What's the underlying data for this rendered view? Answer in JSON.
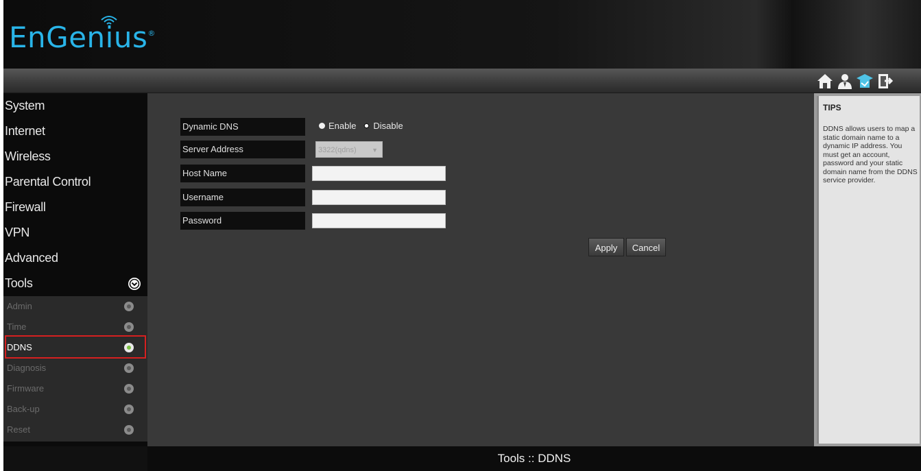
{
  "brand": {
    "logo_text": "EnGenius",
    "logo_color": "#29b4e8"
  },
  "toolbar": {
    "icons": [
      "home-icon",
      "user-icon",
      "wizard-icon",
      "logout-icon"
    ]
  },
  "sidebar": {
    "items": [
      {
        "label": "System"
      },
      {
        "label": "Internet"
      },
      {
        "label": "Wireless"
      },
      {
        "label": "Parental Control"
      },
      {
        "label": "Firewall"
      },
      {
        "label": "VPN"
      },
      {
        "label": "Advanced"
      },
      {
        "label": "Tools"
      }
    ],
    "tools_subitems": [
      {
        "label": "Admin"
      },
      {
        "label": "Time"
      },
      {
        "label": "DDNS"
      },
      {
        "label": "Diagnosis"
      },
      {
        "label": "Firmware"
      },
      {
        "label": "Back-up"
      },
      {
        "label": "Reset"
      }
    ],
    "active_subitem": "DDNS",
    "highlight_color": "#d62020"
  },
  "form": {
    "dynamic_dns_label": "Dynamic DNS",
    "enable_label": "Enable",
    "disable_label": "Disable",
    "selected_option": "Disable",
    "server_address_label": "Server Address",
    "server_address_value": "3322(qdns)",
    "host_name_label": "Host Name",
    "host_name_value": "",
    "username_label": "Username",
    "username_value": "",
    "password_label": "Password",
    "password_value": "",
    "apply_label": "Apply",
    "cancel_label": "Cancel"
  },
  "tips": {
    "title": "TIPS",
    "text": "DDNS allows users to map a static domain name to a dynamic IP address. You must get an account, password and your static domain name from the DDNS service provider."
  },
  "footer": {
    "title": "Tools :: DDNS"
  }
}
